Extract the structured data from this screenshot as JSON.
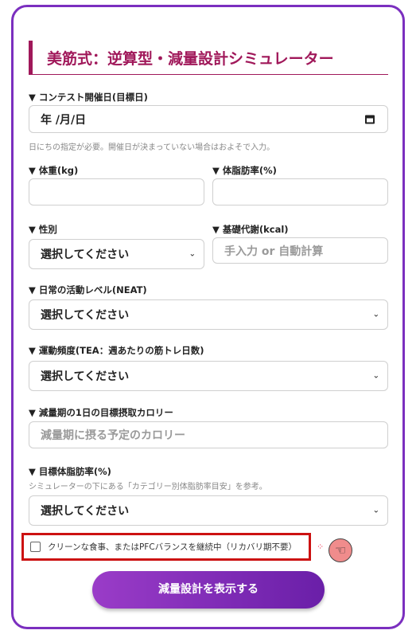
{
  "title": "美筋式：逆算型・減量設計シミュレーター",
  "contest": {
    "label": "▼ コンテスト開催日(目標日)",
    "value": "年 /月/日",
    "hint": "日にちの指定が必要。開催日が決まっていない場合はおよそで入力。"
  },
  "weight": {
    "label": "▼ 体重(kg)",
    "value": ""
  },
  "bodyfat": {
    "label": "▼ 体脂肪率(%)",
    "value": ""
  },
  "sex": {
    "label": "▼ 性別",
    "value": "選択してください"
  },
  "bmr": {
    "label": "▼ 基礎代謝(kcal)",
    "placeholder": "手入力 or 自動計算"
  },
  "neat": {
    "label": "▼ 日常の活動レベル(NEAT)",
    "value": "選択してください"
  },
  "tea": {
    "label": "▼ 運動頻度(TEA：週あたりの筋トレ日数)",
    "value": "選択してください"
  },
  "target_kcal": {
    "label": "▼ 減量期の1日の目標摂取カロリー",
    "placeholder": "減量期に摂る予定のカロリー"
  },
  "target_fat": {
    "label": "▼ 目標体脂肪率(%)",
    "hint": "シミュレーターの下にある「カテゴリー別体脂肪率目安」を参考。",
    "value": "選択してください"
  },
  "checkbox": {
    "label": "クリーンな食事、またはPFCバランスを継続中（リカバリ期不要）",
    "checked": false
  },
  "submit": "減量設計を表示する",
  "colors": {
    "accent": "#7b2fbf",
    "title": "#a0185a",
    "highlight": "#cc1111"
  }
}
